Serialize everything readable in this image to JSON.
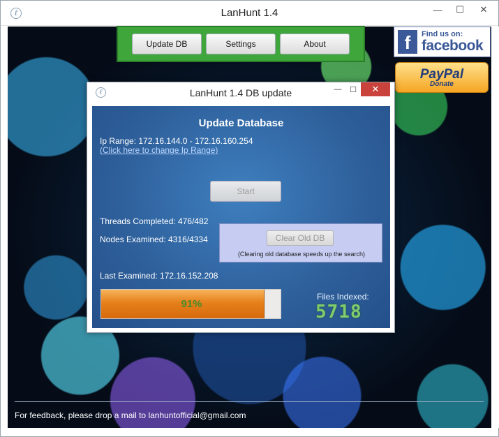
{
  "window": {
    "title": "LanHunt 1.4",
    "controls": {
      "minimize": "—",
      "maximize": "☐",
      "close": "✕"
    }
  },
  "nav": {
    "update_db": "Update DB",
    "settings": "Settings",
    "about": "About"
  },
  "social": {
    "facebook_small": "Find us on:",
    "facebook_big": "facebook",
    "paypal_big": "PayPal",
    "paypal_small": "Donate"
  },
  "footer": {
    "feedback": "For feedback, please drop a mail to lanhuntofficial@gmail.com"
  },
  "dialog": {
    "title": "LanHunt 1.4 DB update",
    "controls": {
      "minimize": "—",
      "maximize": "☐",
      "close": "✕"
    },
    "heading": "Update Database",
    "ip_range": "Ip Range: 172.16.144.0 - 172.16.160.254",
    "change_range_link": "(Click here to change Ip Range)",
    "start_button": "Start",
    "threads_completed": "Threads Completed: 476/482",
    "nodes_examined": "Nodes Examined: 4316/4334",
    "clear_button": "Clear Old DB",
    "clear_note": "(Clearing old database speeds up the search)",
    "last_examined": "Last Examined: 172.16.152.208",
    "progress_value": 91,
    "progress_label": "91%",
    "files_indexed_label": "Files Indexed:",
    "files_indexed_count": "5718"
  },
  "colors": {
    "nav_bg": "#3ea63a",
    "dialog_body": "#2e5f9a",
    "progress_fill": "#e6801a",
    "files_count": "#7fcd6e",
    "clear_panel": "#c6ccf2"
  }
}
